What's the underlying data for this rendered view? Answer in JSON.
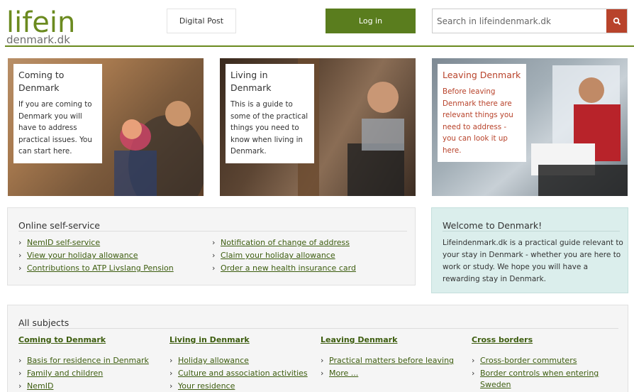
{
  "header": {
    "logo_line1": "lifein",
    "logo_line2": "denmark.dk",
    "digital_post": "Digital Post",
    "login": "Log in",
    "search_placeholder": "Search in lifeindenmark.dk",
    "accent": "#6b8a1f",
    "login_color": "#5a7d1e",
    "search_button_color": "#b8432b"
  },
  "hero": [
    {
      "title": "Coming to Denmark",
      "text": "If you are coming to Denmark you will have to address practical issues. You can start here."
    },
    {
      "title": "Living in Denmark",
      "text": "This is a guide to some of the practical things you need to know when living in Denmark."
    },
    {
      "title": "Leaving Denmark",
      "text": "Before leaving Denmark there are relevant things you need to address - you can look it up here."
    }
  ],
  "online": {
    "title": "Online self-service",
    "left": [
      "NemID self-service",
      "View your holiday allowance",
      "Contributions to ATP Livslang Pension"
    ],
    "right": [
      "Notification of change of address",
      "Claim your holiday allowance",
      "Order a new health insurance card"
    ]
  },
  "welcome": {
    "title": "Welcome to Denmark!",
    "text": "Lifeindenmark.dk is a practical guide relevant to your stay in Denmark - whether you are here to work or study. We hope you will have a rewarding stay in Denmark."
  },
  "subjects": {
    "title": "All subjects",
    "columns": [
      {
        "heading": "Coming to Denmark",
        "links": [
          "Basis for residence in Denmark",
          "Family and children",
          "NemID"
        ]
      },
      {
        "heading": "Living in Denmark",
        "links": [
          "Holiday allowance",
          "Culture and association activities",
          "Your residence"
        ]
      },
      {
        "heading": "Leaving Denmark",
        "links": [
          "Practical matters before leaving",
          "More ..."
        ]
      },
      {
        "heading": "Cross borders",
        "links": [
          "Cross-border commuters",
          "Border controls when entering",
          "Sweden"
        ]
      }
    ]
  },
  "chevron": "›"
}
